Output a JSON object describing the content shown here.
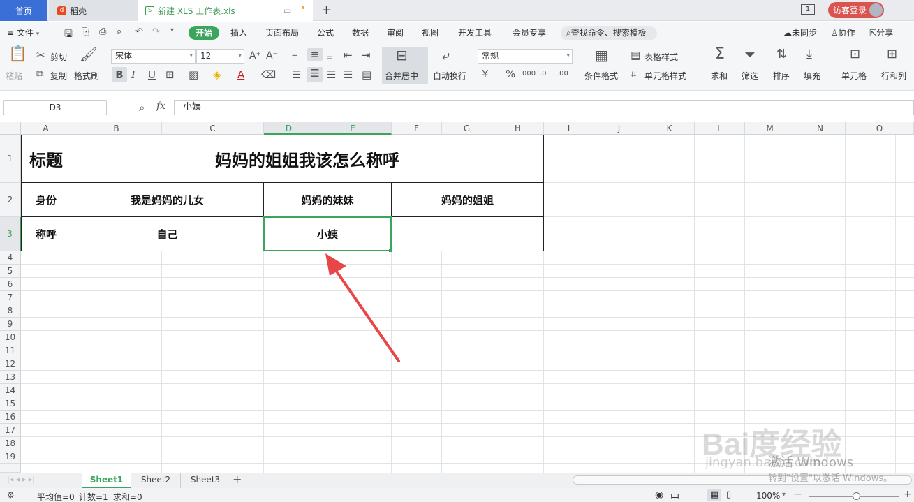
{
  "titlebar": {
    "home_tab": "首页",
    "daoke_tab": "稻壳",
    "file_tab": "新建 XLS 工作表.xls",
    "plus": "+",
    "login": "访客登录"
  },
  "menubar": {
    "file": "≡ 文件",
    "items": [
      "开始",
      "插入",
      "页面布局",
      "公式",
      "数据",
      "审阅",
      "视图",
      "开发工具",
      "会员专享"
    ],
    "search": "查找命令、搜索模板",
    "sync": "未同步",
    "collab": "协作",
    "share": "分享"
  },
  "ribbon": {
    "paste": "粘贴",
    "cut": "剪切",
    "copy": "复制",
    "format_painter": "格式刷",
    "font_name": "宋体",
    "font_size": "12",
    "merge_center": "合并居中",
    "wrap": "自动换行",
    "number_format": "常规",
    "cond_format": "条件格式",
    "table_style": "表格样式",
    "cell_style": "单元格样式",
    "sum": "求和",
    "filter": "筛选",
    "sort": "排序",
    "fill": "填充",
    "cell": "单元格",
    "rowcol": "行和列"
  },
  "formula": {
    "name_box": "D3",
    "fx": "fx",
    "value": "小姨"
  },
  "columns": [
    "A",
    "B",
    "C",
    "D",
    "E",
    "F",
    "G",
    "H",
    "I",
    "J",
    "K",
    "L",
    "M",
    "N",
    "O"
  ],
  "rows": [
    "1",
    "2",
    "3",
    "4",
    "5",
    "6",
    "7",
    "8",
    "9",
    "10",
    "11",
    "12",
    "13",
    "14",
    "15",
    "16",
    "17",
    "18",
    "19"
  ],
  "table": {
    "r1_a": "标题",
    "r1_title": "妈妈的姐姐我该怎么称呼",
    "r2_a": "身份",
    "r2_b": "我是妈妈的儿女",
    "r2_d": "妈妈的妹妹",
    "r2_f": "妈妈的姐姐",
    "r3_a": "称呼",
    "r3_b": "自己",
    "r3_d": "小姨",
    "r3_f": ""
  },
  "sheets": [
    "Sheet1",
    "Sheet2",
    "Sheet3"
  ],
  "status": {
    "average": "平均值=0",
    "count": "计数=1",
    "sum": "求和=0",
    "zoom": "100%"
  },
  "watermark": {
    "activate": "激活 Windows",
    "activate_sub": "转到\"设置\"以激活 Windows。",
    "baidu": "Bai度经验",
    "baidu_url": "jingyan.baidu.com"
  },
  "colors": {
    "accent_green": "#3aa55b",
    "home_tab_blue": "#3a6fd8",
    "arrow_red": "#e8474a",
    "selection_green": "#3aa55b"
  }
}
